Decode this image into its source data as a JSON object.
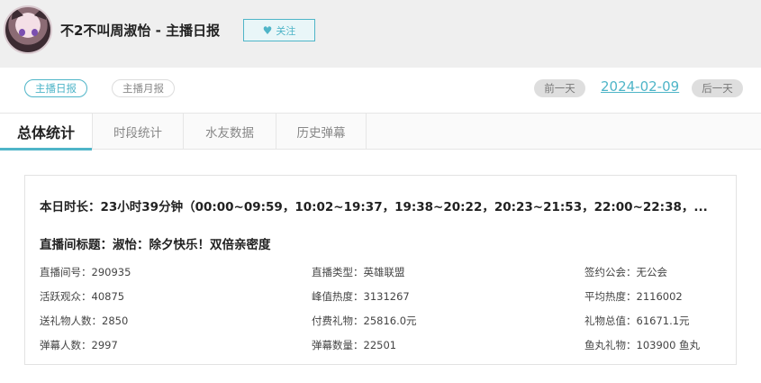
{
  "header": {
    "title": "不2不叫周淑怡 - 主播日报",
    "follow_label": "关注",
    "follow_icon": "heart-icon"
  },
  "report_switch": {
    "daily": "主播日报",
    "monthly": "主播月报"
  },
  "date_nav": {
    "prev": "前一天",
    "date": "2024-02-09",
    "next": "后一天"
  },
  "tabs": [
    {
      "label": "总体统计",
      "active": true
    },
    {
      "label": "时段统计",
      "active": false
    },
    {
      "label": "水友数据",
      "active": false
    },
    {
      "label": "历史弹幕",
      "active": false
    }
  ],
  "summary": {
    "duration": "本日时长：23小时39分钟（00:00~09:59，10:02~19:37，19:38~20:22，20:23~21:53，22:00~22:38，...",
    "room_title": "直播间标题：淑怡：除夕快乐！双倍亲密度",
    "stats": [
      [
        "直播间号：290935",
        "直播类型：英雄联盟",
        "签约公会：无公会"
      ],
      [
        "活跃观众：40875",
        "峰值热度：3131267",
        "平均热度：2116002"
      ],
      [
        "送礼物人数：2850",
        "付费礼物：25816.0元",
        "礼物总值：61671.1元"
      ],
      [
        "弹幕人数：2997",
        "弹幕数量：22501",
        "鱼丸礼物：103900 鱼丸"
      ]
    ]
  },
  "colors": {
    "accent": "#4fb5c8",
    "header_bg": "#efefef"
  }
}
